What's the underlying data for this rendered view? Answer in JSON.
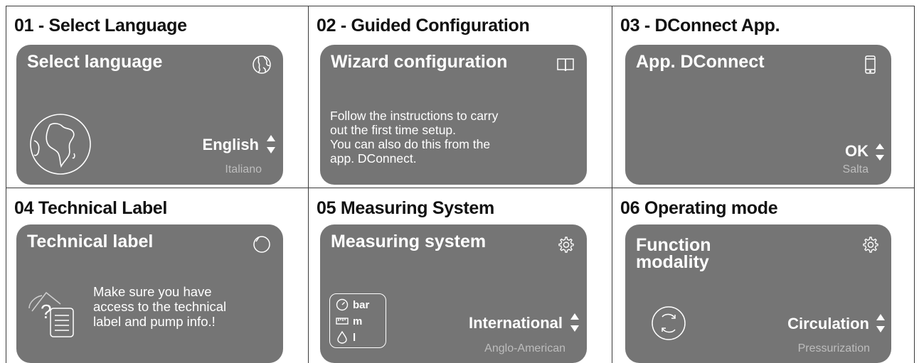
{
  "colors": {
    "screen_bg": "#757575",
    "screen_text": "#ffffff",
    "sub_text": "#bdbdbd",
    "grid_line": "#3a3a3a"
  },
  "steps": [
    {
      "title": "01 - Select Language",
      "screen_title": "Select language",
      "corner_icon": "globe-icon",
      "selected": "English",
      "alternative": "Italiano",
      "illustration": "earth-africa-icon"
    },
    {
      "title": "02 - Guided Configuration",
      "screen_title": "Wizard configuration",
      "corner_icon": "book-icon",
      "body": [
        "Follow the instructions to carry",
        "out the first time setup.",
        "You can also do this from the",
        "app. DConnect."
      ]
    },
    {
      "title": "03 - DConnect App.",
      "screen_title": "App. DConnect",
      "corner_icon": "smartphone-icon",
      "selected": "OK",
      "alternative": "Salta"
    },
    {
      "title": "04 Technical Label",
      "screen_title": "Technical label",
      "corner_icon": "circle-icon",
      "body": [
        "Make sure you have",
        "access to the technical",
        "label and pump info.!"
      ],
      "illustration": "question-document-icon"
    },
    {
      "title": "05 Measuring System",
      "screen_title": "Measuring system",
      "corner_icon": "gear-icon",
      "selected": "International",
      "alternative": "Anglo-American",
      "units": [
        "bar",
        "m",
        "l"
      ]
    },
    {
      "title": "06 Operating mode",
      "screen_title_lines": [
        "Function",
        "modality"
      ],
      "corner_icon": "gear-icon",
      "selected": "Circulation",
      "alternative": "Pressurization",
      "illustration": "circulation-arrows-icon"
    }
  ]
}
